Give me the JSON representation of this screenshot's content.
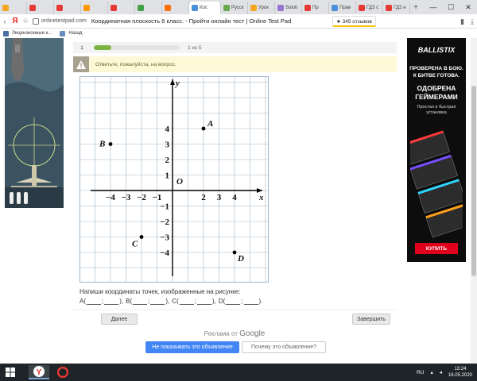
{
  "browser": {
    "tabs": [
      {
        "label": "",
        "color": "#f5a623"
      },
      {
        "label": "",
        "color": "#e53935"
      },
      {
        "label": "",
        "color": "#e53935"
      },
      {
        "label": "",
        "color": "#ff9800"
      },
      {
        "label": "",
        "color": "#e53935"
      },
      {
        "label": "",
        "color": "#43a047"
      },
      {
        "label": "",
        "color": "#ff6f00"
      },
      {
        "label": "Кос",
        "color": "#4a90d9"
      },
      {
        "label": "Русск",
        "color": "#6aa84f"
      },
      {
        "label": "Урок",
        "color": "#f5a623"
      },
      {
        "label": "Soluti",
        "color": "#9575cd"
      },
      {
        "label": "Пр",
        "color": "#e53935"
      },
      {
        "label": "Прав",
        "color": "#4a90d9"
      },
      {
        "label": "ГДЗ с",
        "color": "#e53935"
      },
      {
        "label": "ГДЗ н",
        "color": "#e53935"
      }
    ],
    "new_tab": "+",
    "window_controls": {
      "minimize": "—",
      "maximize": "☐",
      "close": "✕"
    },
    "address": {
      "yandex": "Я",
      "url": "onlinetestpad.com",
      "title": "Координатная плоскость 6 класс. - Пройти онлайн тест | Online Test Pad",
      "reviews": "★ 345 отзывов"
    },
    "bookmarks": [
      {
        "label": "Лицензионные к..."
      },
      {
        "label": "Назад"
      }
    ]
  },
  "progress": {
    "question_number": "1",
    "counter": "1 из 5",
    "fraction": 0.2
  },
  "notice": {
    "text": "Ответьте, пожалуйста, на вопрос."
  },
  "graph": {
    "y_axis_label": "y",
    "x_axis_label": "x",
    "origin_label": "O",
    "x_ticks": [
      "−4",
      "−3",
      "−2",
      "−1",
      "2",
      "3",
      "4"
    ],
    "y_ticks": [
      "4",
      "3",
      "2",
      "1",
      "−1",
      "−2",
      "−3",
      "−4"
    ],
    "points": [
      {
        "name": "A",
        "x": 2,
        "y": 4
      },
      {
        "name": "B",
        "x": -4,
        "y": 3
      },
      {
        "name": "C",
        "x": -2,
        "y": -3
      },
      {
        "name": "D",
        "x": 4,
        "y": -4
      }
    ]
  },
  "question": {
    "text": "Напиши координаты точек, изображенные на рисунке:",
    "answer_template": [
      {
        "prefix": "A(",
        "sep": ";",
        "suffix": "),"
      },
      {
        "prefix": "B(",
        "sep": ";",
        "suffix": "),"
      },
      {
        "prefix": "C(",
        "sep": ";",
        "suffix": "),"
      },
      {
        "prefix": "D(",
        "sep": ";",
        "suffix": ")."
      }
    ]
  },
  "buttons": {
    "next": "Далее",
    "finish": "Завершить"
  },
  "ad_footer": {
    "prefix": "Реклама от",
    "google": "Google",
    "hide_button": "Не показывать это объявление",
    "why_button": "Почему это объявление?"
  },
  "ad_right": {
    "brand": "BALLISTIX",
    "line1": "ПРОВЕРЕНА В БОЮ.",
    "line2": "К БИТВЕ ГОТОВА.",
    "line3": "ОДОБРЕНА",
    "line4": "ГЕЙМЕРАМИ",
    "line5": "Простая и быстрая установка",
    "cta": "КУПИТЬ"
  },
  "taskbar": {
    "lang": "RU",
    "time": "13:24",
    "date": "16.05.2020"
  }
}
